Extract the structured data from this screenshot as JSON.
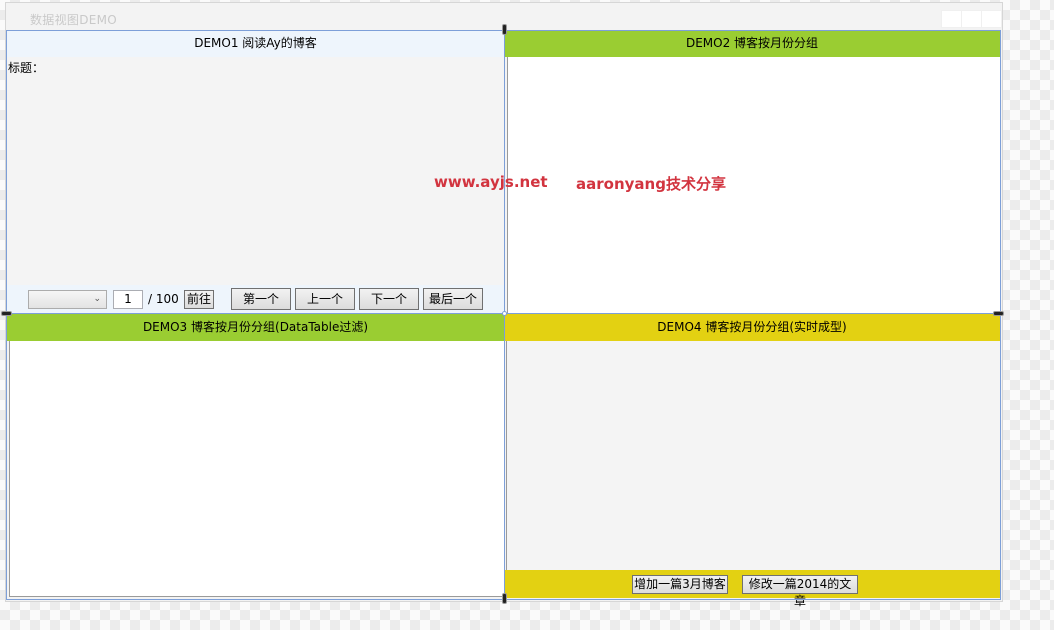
{
  "window": {
    "title": "数据视图DEMO"
  },
  "colors": {
    "demo1_header": "#eef5fc",
    "demo2_header": "#9acd32",
    "demo3_header": "#9acd32",
    "demo4_header": "#e3d112",
    "watermark": "#d2343f"
  },
  "demo1": {
    "header": "DEMO1 阅读Ay的博客",
    "title_label": "标题：",
    "pager": {
      "select_value": "",
      "page_input": "1",
      "total": "/ 100",
      "go_label": "前往",
      "first_label": "第一个",
      "prev_label": "上一个",
      "next_label": "下一个",
      "last_label": "最后一个"
    }
  },
  "demo2": {
    "header": "DEMO2 博客按月份分组"
  },
  "demo3": {
    "header": "DEMO3 博客按月份分组(DataTable过滤)"
  },
  "demo4": {
    "header": "DEMO4 博客按月份分组(实时成型)",
    "add_label": "增加一篇3月博客",
    "modify_label": "修改一篇2014的文章"
  },
  "watermark": {
    "site": "www.ayjs.net",
    "author": "aaronyang技术分享"
  }
}
